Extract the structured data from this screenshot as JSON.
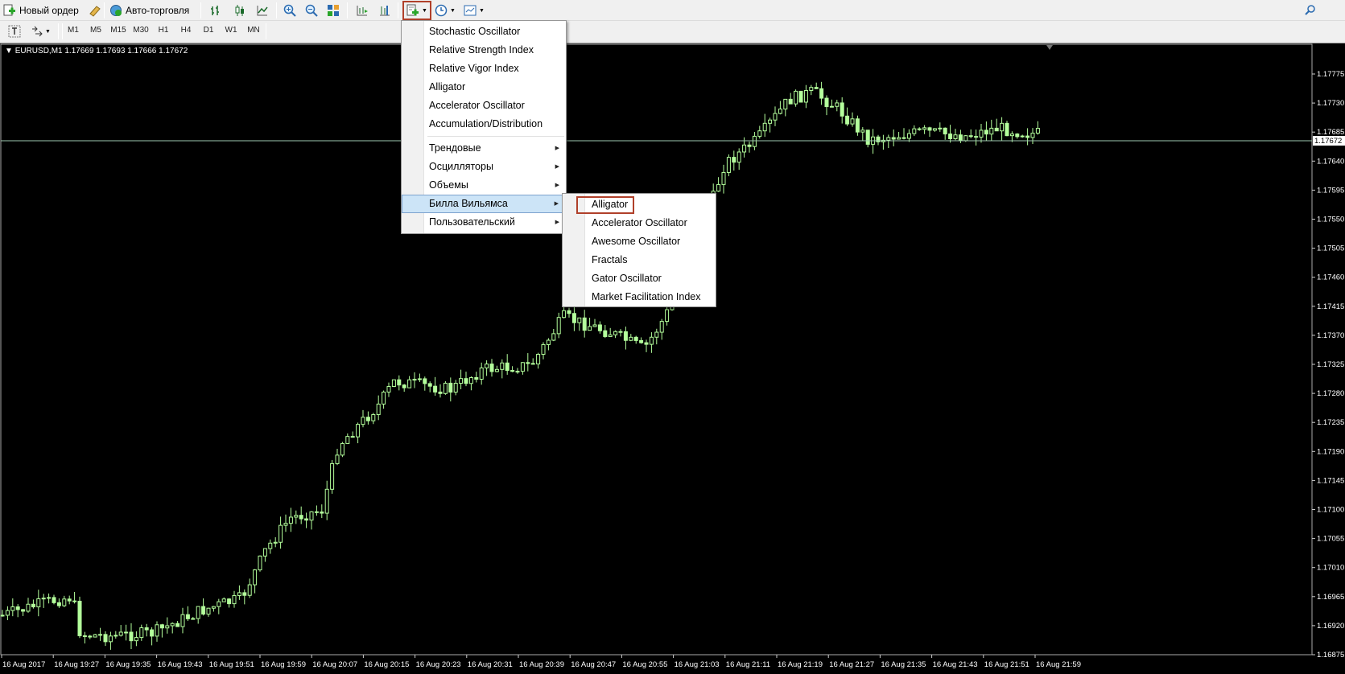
{
  "toolbar": {
    "new_order_label": "Новый ордер",
    "auto_trading_label": "Авто-торговля"
  },
  "timeframes": [
    "M1",
    "M5",
    "M15",
    "M30",
    "H1",
    "H4",
    "D1",
    "W1",
    "MN"
  ],
  "chart": {
    "symbol_info": "EURUSD,M1  1.17669 1.17693 1.17666 1.17672",
    "current_price": "1.17672",
    "price_labels": [
      "1.17775",
      "1.17730",
      "1.17685",
      "1.17640",
      "1.17595",
      "1.17550",
      "1.17505",
      "1.17460",
      "1.17415",
      "1.17370",
      "1.17325",
      "1.17280",
      "1.17235",
      "1.17190",
      "1.17145",
      "1.17100",
      "1.17055",
      "1.17010",
      "1.16965",
      "1.16920",
      "1.16875"
    ],
    "time_labels": [
      "16 Aug 2017",
      "16 Aug 19:27",
      "16 Aug 19:35",
      "16 Aug 19:43",
      "16 Aug 19:51",
      "16 Aug 19:59",
      "16 Aug 20:07",
      "16 Aug 20:15",
      "16 Aug 20:23",
      "16 Aug 20:31",
      "16 Aug 20:39",
      "16 Aug 20:47",
      "16 Aug 20:55",
      "16 Aug 21:03",
      "16 Aug 21:11",
      "16 Aug 21:19",
      "16 Aug 21:27",
      "16 Aug 21:35",
      "16 Aug 21:43",
      "16 Aug 21:51",
      "16 Aug 21:59"
    ],
    "candle_color": "#b4ff9c",
    "background": "#000000"
  },
  "indicators_menu": {
    "items": [
      "Stochastic Oscillator",
      "Relative Strength Index",
      "Relative Vigor Index",
      "Alligator",
      "Accelerator Oscillator",
      "Accumulation/Distribution"
    ],
    "submenus": [
      "Трендовые",
      "Осцилляторы",
      "Объемы",
      "Билла Вильямса",
      "Пользовательский"
    ]
  },
  "williams_menu": {
    "items": [
      "Alligator",
      "Accelerator Oscillator",
      "Awesome Oscillator",
      "Fractals",
      "Gator Oscillator",
      "Market Facilitation Index"
    ]
  },
  "colors": {
    "highlight": "#cce4f7",
    "callout": "#b0402a"
  }
}
